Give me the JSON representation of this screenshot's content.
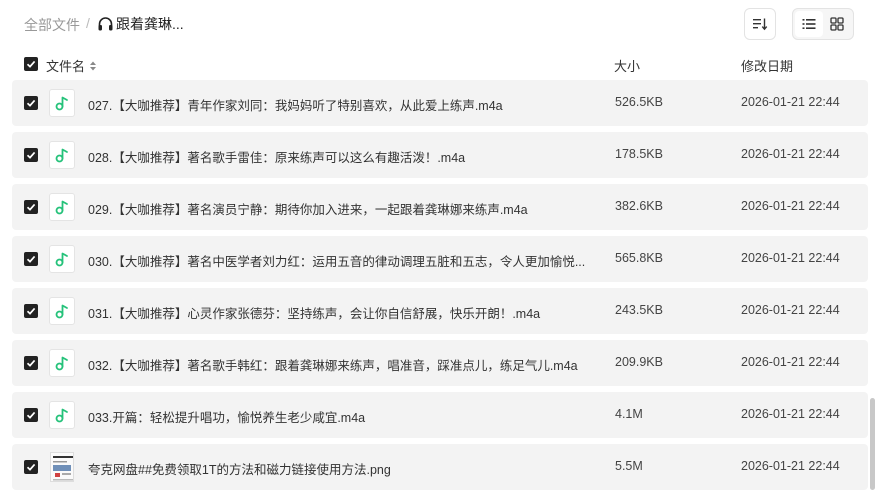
{
  "breadcrumb": {
    "root": "全部文件",
    "separator": "/",
    "current": "跟着龚琳..."
  },
  "toolbar": {
    "sort_icon": "sort-lines-icon",
    "list_view_icon": "list-view-icon",
    "grid_view_icon": "grid-view-icon",
    "active_view": "list"
  },
  "columns": {
    "name": "文件名",
    "size": "大小",
    "date": "修改日期"
  },
  "colors": {
    "audio_icon": "#25c27a",
    "row_bg": "#f3f3f3",
    "checkbox": "#222222"
  },
  "files": [
    {
      "name": "027.【大咖推荐】青年作家刘同：我妈妈听了特别喜欢，从此爱上练声.m4a",
      "size": "526.5KB",
      "date": "2026-01-21 22:44",
      "type": "audio",
      "checked": true
    },
    {
      "name": "028.【大咖推荐】著名歌手雷佳：原来练声可以这么有趣活泼！.m4a",
      "size": "178.5KB",
      "date": "2026-01-21 22:44",
      "type": "audio",
      "checked": true
    },
    {
      "name": "029.【大咖推荐】著名演员宁静：期待你加入进来，一起跟着龚琳娜来练声.m4a",
      "size": "382.6KB",
      "date": "2026-01-21 22:44",
      "type": "audio",
      "checked": true
    },
    {
      "name": "030.【大咖推荐】著名中医学者刘力红：运用五音的律动调理五脏和五志，令人更加愉悦...",
      "size": "565.8KB",
      "date": "2026-01-21 22:44",
      "type": "audio",
      "checked": true
    },
    {
      "name": "031.【大咖推荐】心灵作家张德芬：坚持练声，会让你自信舒展，快乐开朗！.m4a",
      "size": "243.5KB",
      "date": "2026-01-21 22:44",
      "type": "audio",
      "checked": true
    },
    {
      "name": "032.【大咖推荐】著名歌手韩红：跟着龚琳娜来练声，唱准音，踩准点儿，练足气儿.m4a",
      "size": "209.9KB",
      "date": "2026-01-21 22:44",
      "type": "audio",
      "checked": true
    },
    {
      "name": "033.开篇：轻松提升唱功，愉悦养生老少咸宜.m4a",
      "size": "4.1M",
      "date": "2026-01-21 22:44",
      "type": "audio",
      "checked": true
    },
    {
      "name": "夸克网盘##免费领取1T的方法和磁力链接使用方法.png",
      "size": "5.5M",
      "date": "2026-01-21 22:44",
      "type": "image",
      "checked": true
    }
  ]
}
